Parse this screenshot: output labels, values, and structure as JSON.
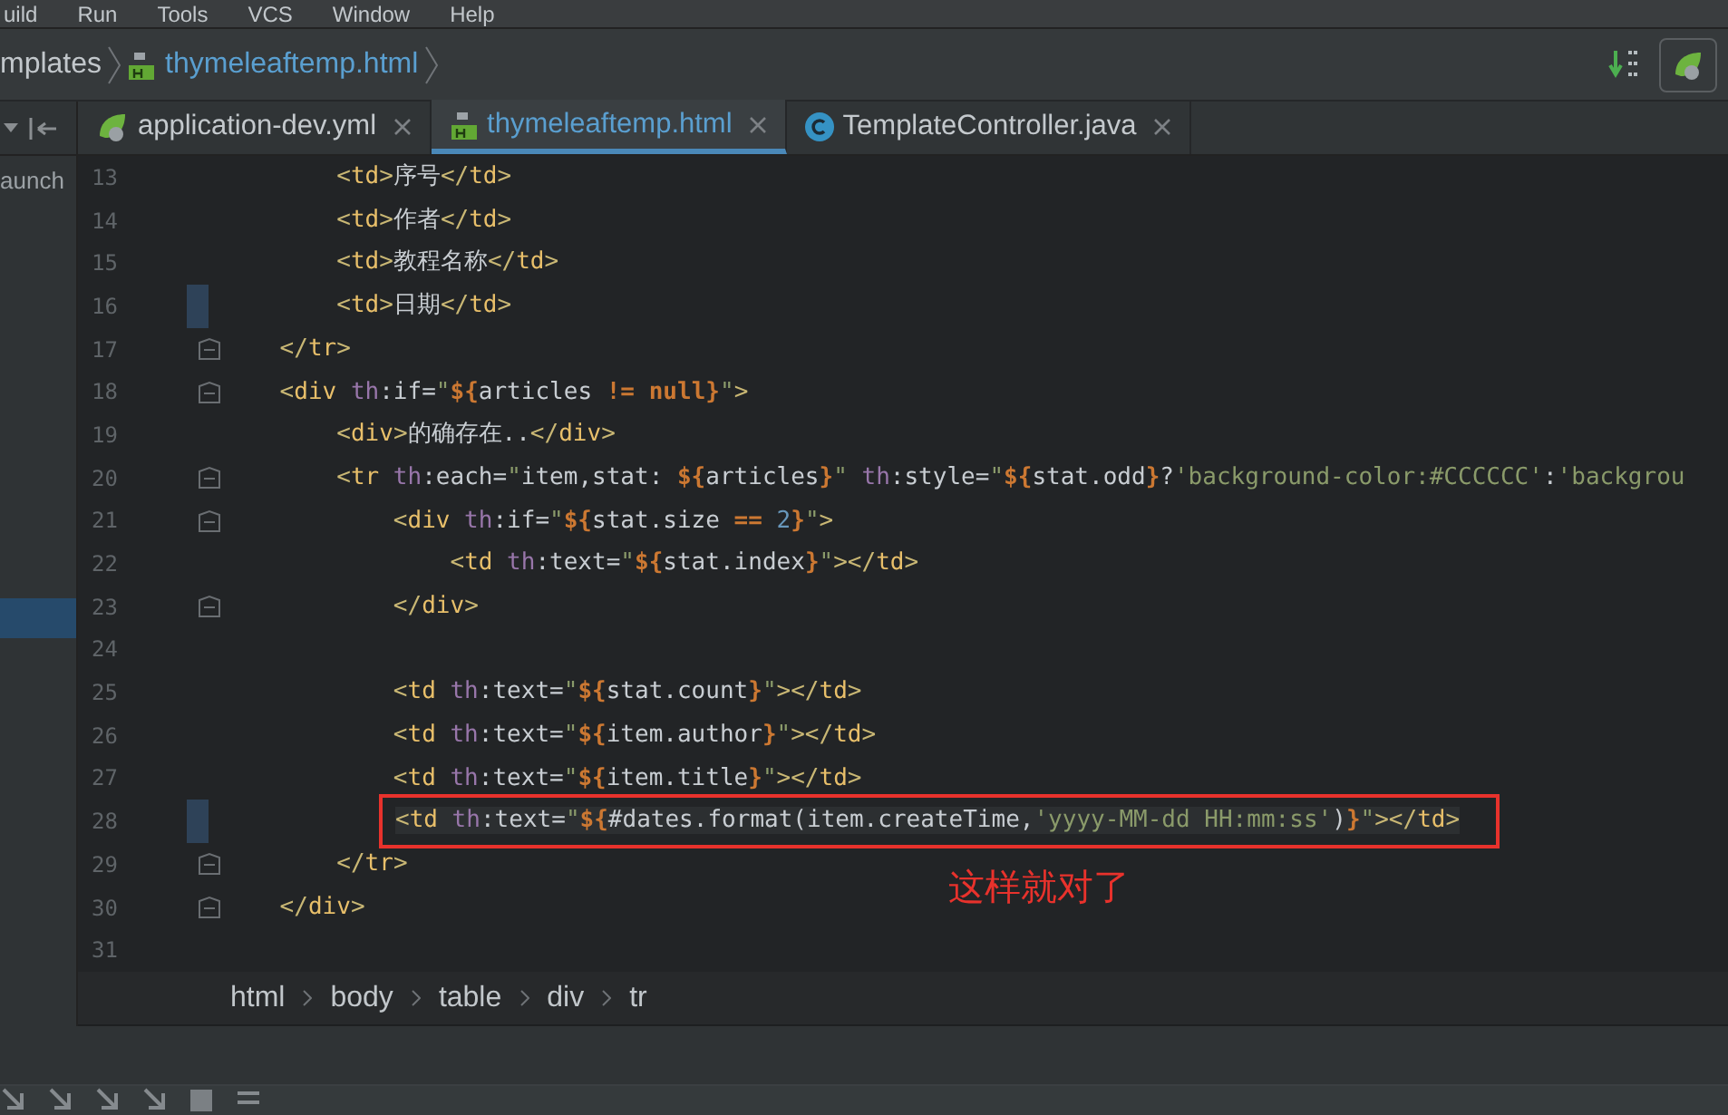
{
  "menu": [
    "uild",
    "Run",
    "Tools",
    "VCS",
    "Window",
    "Help"
  ],
  "nav_breadcrumb": [
    {
      "label": "mplates",
      "kind": "folder"
    },
    {
      "label": "thymeleaftemp.html",
      "kind": "html"
    }
  ],
  "project_panel": {
    "label": "aunch"
  },
  "tabs": [
    {
      "label": "application-dev.yml",
      "kind": "spring",
      "selected": false
    },
    {
      "label": "thymeleaftemp.html",
      "kind": "html",
      "selected": true
    },
    {
      "label": "TemplateController.java",
      "kind": "class",
      "selected": false
    }
  ],
  "lines": [
    {
      "n": "13",
      "fold": false,
      "changed": false,
      "tokens": [
        {
          "kind": "p",
          "t": "        <"
        },
        {
          "kind": "tag",
          "t": "td"
        },
        {
          "kind": "p",
          "t": ">"
        },
        {
          "kind": "text",
          "t": "序号"
        },
        {
          "kind": "p",
          "t": "</"
        },
        {
          "kind": "tag",
          "t": "td"
        },
        {
          "kind": "p",
          "t": ">"
        }
      ]
    },
    {
      "n": "14",
      "fold": false,
      "changed": false,
      "tokens": [
        {
          "kind": "p",
          "t": "        <"
        },
        {
          "kind": "tag",
          "t": "td"
        },
        {
          "kind": "p",
          "t": ">"
        },
        {
          "kind": "text",
          "t": "作者"
        },
        {
          "kind": "p",
          "t": "</"
        },
        {
          "kind": "tag",
          "t": "td"
        },
        {
          "kind": "p",
          "t": ">"
        }
      ]
    },
    {
      "n": "15",
      "fold": false,
      "changed": false,
      "tokens": [
        {
          "kind": "p",
          "t": "        <"
        },
        {
          "kind": "tag",
          "t": "td"
        },
        {
          "kind": "p",
          "t": ">"
        },
        {
          "kind": "text",
          "t": "教程名称"
        },
        {
          "kind": "p",
          "t": "</"
        },
        {
          "kind": "tag",
          "t": "td"
        },
        {
          "kind": "p",
          "t": ">"
        }
      ]
    },
    {
      "n": "16",
      "fold": false,
      "changed": true,
      "tokens": [
        {
          "kind": "p",
          "t": "        <"
        },
        {
          "kind": "tag",
          "t": "td"
        },
        {
          "kind": "p",
          "t": ">"
        },
        {
          "kind": "text",
          "t": "日期"
        },
        {
          "kind": "p",
          "t": "</"
        },
        {
          "kind": "tag",
          "t": "td"
        },
        {
          "kind": "p",
          "t": ">"
        }
      ]
    },
    {
      "n": "17",
      "fold": true,
      "changed": false,
      "tokens": [
        {
          "kind": "p",
          "t": "    </"
        },
        {
          "kind": "tag",
          "t": "tr"
        },
        {
          "kind": "p",
          "t": ">"
        }
      ]
    },
    {
      "n": "18",
      "fold": true,
      "changed": false,
      "tokens": [
        {
          "kind": "p",
          "t": "    <"
        },
        {
          "kind": "tag",
          "t": "div"
        },
        {
          "kind": "attr",
          "t": " th"
        },
        {
          "kind": "text",
          "t": ":if="
        },
        {
          "kind": "str",
          "t": "\""
        },
        {
          "kind": "expr",
          "t": "${"
        },
        {
          "kind": "text",
          "t": "articles"
        },
        {
          "kind": "expr",
          "t": " != null}"
        },
        {
          "kind": "str",
          "t": "\""
        },
        {
          "kind": "p",
          "t": ">"
        }
      ]
    },
    {
      "n": "19",
      "fold": false,
      "changed": false,
      "tokens": [
        {
          "kind": "p",
          "t": "        <"
        },
        {
          "kind": "tag",
          "t": "div"
        },
        {
          "kind": "p",
          "t": ">"
        },
        {
          "kind": "text",
          "t": "的确存在.."
        },
        {
          "kind": "p",
          "t": "</"
        },
        {
          "kind": "tag",
          "t": "div"
        },
        {
          "kind": "p",
          "t": ">"
        }
      ]
    },
    {
      "n": "20",
      "fold": true,
      "changed": false,
      "tokens": [
        {
          "kind": "p",
          "t": "        <"
        },
        {
          "kind": "tag",
          "t": "tr"
        },
        {
          "kind": "attr",
          "t": " th"
        },
        {
          "kind": "text",
          "t": ":each="
        },
        {
          "kind": "str",
          "t": "\""
        },
        {
          "kind": "text",
          "t": "item,stat: "
        },
        {
          "kind": "expr",
          "t": "${"
        },
        {
          "kind": "text",
          "t": "articles"
        },
        {
          "kind": "expr",
          "t": "}"
        },
        {
          "kind": "str",
          "t": "\""
        },
        {
          "kind": "attr",
          "t": " th"
        },
        {
          "kind": "text",
          "t": ":style="
        },
        {
          "kind": "str",
          "t": "\""
        },
        {
          "kind": "expr",
          "t": "${"
        },
        {
          "kind": "text",
          "t": "stat.odd"
        },
        {
          "kind": "expr",
          "t": "}"
        },
        {
          "kind": "text",
          "t": "?"
        },
        {
          "kind": "str",
          "t": "'background-color:#CCCCCC'"
        },
        {
          "kind": "text",
          "t": ":"
        },
        {
          "kind": "str",
          "t": "'backgrou"
        }
      ]
    },
    {
      "n": "21",
      "fold": true,
      "changed": false,
      "tokens": [
        {
          "kind": "p",
          "t": "            <"
        },
        {
          "kind": "tag",
          "t": "div"
        },
        {
          "kind": "attr",
          "t": " th"
        },
        {
          "kind": "text",
          "t": ":if="
        },
        {
          "kind": "str",
          "t": "\""
        },
        {
          "kind": "expr",
          "t": "${"
        },
        {
          "kind": "text",
          "t": "stat.size"
        },
        {
          "kind": "expr",
          "t": " =="
        },
        {
          "kind": "num",
          "t": " 2"
        },
        {
          "kind": "expr",
          "t": "}"
        },
        {
          "kind": "str",
          "t": "\""
        },
        {
          "kind": "p",
          "t": ">"
        }
      ]
    },
    {
      "n": "22",
      "fold": false,
      "changed": false,
      "tokens": [
        {
          "kind": "p",
          "t": "                <"
        },
        {
          "kind": "tag",
          "t": "td"
        },
        {
          "kind": "attr",
          "t": " th"
        },
        {
          "kind": "text",
          "t": ":text="
        },
        {
          "kind": "str",
          "t": "\""
        },
        {
          "kind": "expr",
          "t": "${"
        },
        {
          "kind": "text",
          "t": "stat.index"
        },
        {
          "kind": "expr",
          "t": "}"
        },
        {
          "kind": "str",
          "t": "\""
        },
        {
          "kind": "p",
          "t": "></"
        },
        {
          "kind": "tag",
          "t": "td"
        },
        {
          "kind": "p",
          "t": ">"
        }
      ]
    },
    {
      "n": "23",
      "fold": true,
      "changed": false,
      "tokens": [
        {
          "kind": "p",
          "t": "            </"
        },
        {
          "kind": "tag",
          "t": "div"
        },
        {
          "kind": "p",
          "t": ">"
        }
      ]
    },
    {
      "n": "24",
      "fold": false,
      "changed": false
    },
    {
      "n": "25",
      "fold": false,
      "changed": false,
      "tokens": [
        {
          "kind": "p",
          "t": "            <"
        },
        {
          "kind": "tag",
          "t": "td"
        },
        {
          "kind": "attr",
          "t": " th"
        },
        {
          "kind": "text",
          "t": ":text="
        },
        {
          "kind": "str",
          "t": "\""
        },
        {
          "kind": "expr",
          "t": "${"
        },
        {
          "kind": "text",
          "t": "stat.count"
        },
        {
          "kind": "expr",
          "t": "}"
        },
        {
          "kind": "str",
          "t": "\""
        },
        {
          "kind": "p",
          "t": "></"
        },
        {
          "kind": "tag",
          "t": "td"
        },
        {
          "kind": "p",
          "t": ">"
        }
      ]
    },
    {
      "n": "26",
      "fold": false,
      "changed": false,
      "tokens": [
        {
          "kind": "p",
          "t": "            <"
        },
        {
          "kind": "tag",
          "t": "td"
        },
        {
          "kind": "attr",
          "t": " th"
        },
        {
          "kind": "text",
          "t": ":text="
        },
        {
          "kind": "str",
          "t": "\""
        },
        {
          "kind": "expr",
          "t": "${"
        },
        {
          "kind": "text",
          "t": "item.author"
        },
        {
          "kind": "expr",
          "t": "}"
        },
        {
          "kind": "str",
          "t": "\""
        },
        {
          "kind": "p",
          "t": "></"
        },
        {
          "kind": "tag",
          "t": "td"
        },
        {
          "kind": "p",
          "t": ">"
        }
      ]
    },
    {
      "n": "27",
      "fold": false,
      "changed": false,
      "tokens": [
        {
          "kind": "p",
          "t": "            <"
        },
        {
          "kind": "tag",
          "t": "td"
        },
        {
          "kind": "attr",
          "t": " th"
        },
        {
          "kind": "text",
          "t": ":text="
        },
        {
          "kind": "str",
          "t": "\""
        },
        {
          "kind": "expr",
          "t": "${"
        },
        {
          "kind": "text",
          "t": "item.title"
        },
        {
          "kind": "expr",
          "t": "}"
        },
        {
          "kind": "str",
          "t": "\""
        },
        {
          "kind": "p",
          "t": "></"
        },
        {
          "kind": "tag",
          "t": "td"
        },
        {
          "kind": "p",
          "t": ">"
        }
      ]
    },
    {
      "n": "28",
      "fold": false,
      "changed": true,
      "highlighted": true,
      "tokens": [
        {
          "kind": "p",
          "t": "<"
        },
        {
          "kind": "tag",
          "t": "td"
        },
        {
          "kind": "attr",
          "t": " th"
        },
        {
          "kind": "text",
          "t": ":text="
        },
        {
          "kind": "str",
          "t": "\""
        },
        {
          "kind": "expr",
          "t": "${"
        },
        {
          "kind": "text",
          "t": "#dates.format(item.createTime,"
        },
        {
          "kind": "str",
          "t": "'yyyy-MM-dd HH:mm:ss'"
        },
        {
          "kind": "text",
          "t": ")"
        },
        {
          "kind": "expr",
          "t": "}"
        },
        {
          "kind": "str",
          "t": "\""
        },
        {
          "kind": "p",
          "t": "></"
        },
        {
          "kind": "tag",
          "t": "td"
        },
        {
          "kind": "p",
          "t": ">"
        }
      ]
    },
    {
      "n": "29",
      "fold": true,
      "changed": false,
      "tokens": [
        {
          "kind": "p",
          "t": "        </"
        },
        {
          "kind": "tag",
          "t": "tr"
        },
        {
          "kind": "p",
          "t": ">"
        }
      ]
    },
    {
      "n": "30",
      "fold": true,
      "changed": false,
      "tokens": [
        {
          "kind": "p",
          "t": "    </"
        },
        {
          "kind": "tag",
          "t": "div"
        },
        {
          "kind": "p",
          "t": ">"
        }
      ]
    },
    {
      "n": "31",
      "fold": false,
      "changed": false
    }
  ],
  "annotation": "这样就对了",
  "tag_breadcrumb": [
    "html",
    "body",
    "table",
    "div",
    "tr"
  ]
}
